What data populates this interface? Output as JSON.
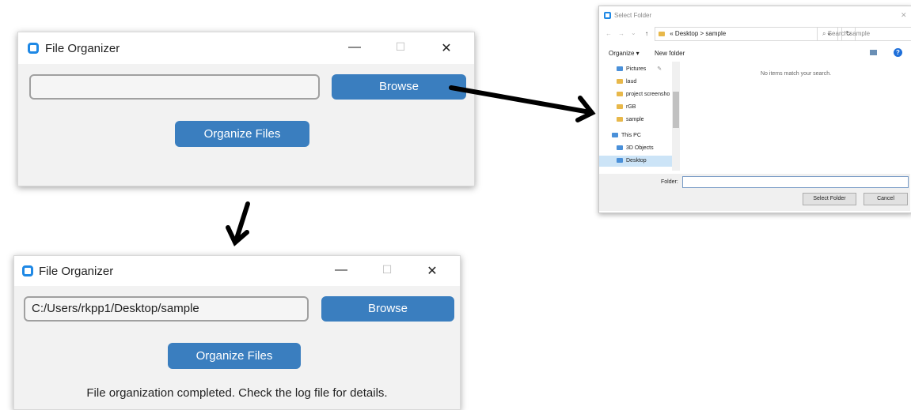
{
  "window_top": {
    "title": "File Organizer",
    "controls": {
      "minimize": "—",
      "maximize": "☐",
      "close": "✕"
    },
    "path_value": "",
    "browse_label": "Browse",
    "organize_label": "Organize Files"
  },
  "window_bottom": {
    "title": "File Organizer",
    "controls": {
      "minimize": "—",
      "maximize": "☐",
      "close": "✕"
    },
    "path_value": "C:/Users/rkpp1/Desktop/sample",
    "browse_label": "Browse",
    "organize_label": "Organize Files",
    "status": "File organization completed. Check the log file for details."
  },
  "dialog": {
    "title": "Select Folder",
    "nav": {
      "back": "←",
      "forward": "→",
      "up": "↑",
      "recent": "⌄"
    },
    "breadcrumb": {
      "root": "«",
      "parts": [
        "Desktop",
        "sample"
      ],
      "separator": ">"
    },
    "refresh": "↻",
    "dropdown": "⌄",
    "search_placeholder": "Search sample",
    "toolbar": {
      "organize": "Organize ▾",
      "new_folder": "New folder",
      "help": "?"
    },
    "empty_message": "No items match your search.",
    "tree": [
      {
        "label": "Pictures",
        "kind": "folder"
      },
      {
        "label": "laud",
        "kind": "folder"
      },
      {
        "label": "project screensho",
        "kind": "folder"
      },
      {
        "label": "rGB",
        "kind": "folder"
      },
      {
        "label": "sample",
        "kind": "folder"
      },
      {
        "label": "This PC",
        "kind": "pc"
      },
      {
        "label": "3D Objects",
        "kind": "pc"
      },
      {
        "label": "Desktop",
        "kind": "pc"
      }
    ],
    "folder_label": "Folder:",
    "folder_value": "",
    "select_label": "Select Folder",
    "cancel_label": "Cancel",
    "close": "✕"
  },
  "colors": {
    "accent": "#3a7ebf",
    "icon_blue": "#1e88e5",
    "window_bg": "#f2f2f2"
  }
}
